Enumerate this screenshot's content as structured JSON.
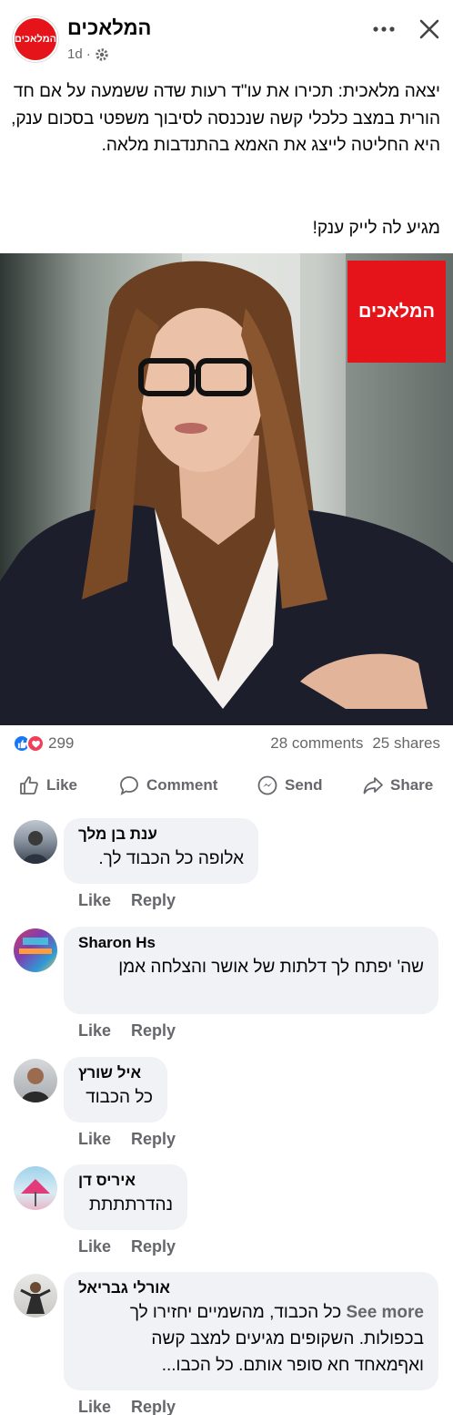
{
  "header": {
    "page_name": "המלאכים",
    "logo_text": "המלאכים",
    "time": "1d",
    "dot": "·"
  },
  "post": {
    "text": "יצאה מלאכית: תכירו את עו\"ד רעות שדה ששמעה על אם חד הורית במצב כלכלי קשה שנכנסה לסיבוך משפטי בסכום ענק, היא החליטה לייצג את האמא בהתנדבות מלאה.",
    "cta": "מגיע לה לייק ענק!",
    "image_logo_text": "המלאכים"
  },
  "stats": {
    "reactions_count": "299",
    "comments": "28 comments",
    "shares": "25 shares"
  },
  "actions": {
    "like": "Like",
    "comment": "Comment",
    "send": "Send",
    "share": "Share"
  },
  "comment_actions": {
    "like": "Like",
    "reply": "Reply"
  },
  "comments": [
    {
      "name": "ענת בן מלך",
      "text": "אלופה כל הכבוד לך."
    },
    {
      "name": "Sharon Hs",
      "text": "שה' יפתח לך דלתות של אושר והצלחה אמן"
    },
    {
      "name": "איל שורץ",
      "text": "כל הכבוד"
    },
    {
      "name": "איריס דן",
      "text": "נהדרתתתת"
    },
    {
      "name": "אורלי גבריאל",
      "text": "כל הכבוד, מהשמיים יחזירו לך בכפולות. השקופים מגיעים למצב קשה ואףמאחד חא סופר אותם. כל הכבו...",
      "see_more": "See more"
    }
  ],
  "colors": {
    "brand_red": "#e5141b",
    "facebook_blue": "#1877f2",
    "love_red": "#f33e58",
    "secondary_text": "#65676b",
    "bubble_bg": "#f0f2f5"
  }
}
